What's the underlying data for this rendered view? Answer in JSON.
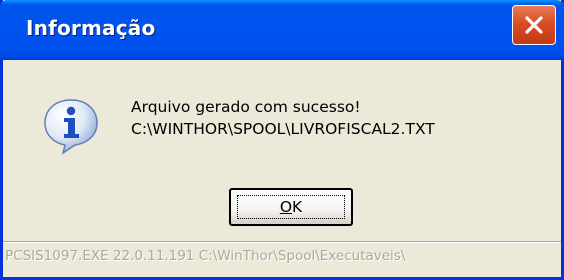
{
  "window": {
    "title": "Informação"
  },
  "message": {
    "line1": "Arquivo gerado com sucesso!",
    "line2": "C:\\WINTHOR\\SPOOL\\LIVROFISCAL2.TXT",
    "icon": "information-icon"
  },
  "buttons": {
    "ok_label_underlined": "O",
    "ok_label_rest": "K"
  },
  "statusbar": {
    "text": "PCSIS1097.EXE 22.0.11.191 C:\\WinThor\\Spool\\Executaveis\\"
  },
  "colors": {
    "titlebar": "#0053ee",
    "window_bg": "#ece9d8",
    "close_button": "#d64a24",
    "status_text": "#aca899"
  }
}
